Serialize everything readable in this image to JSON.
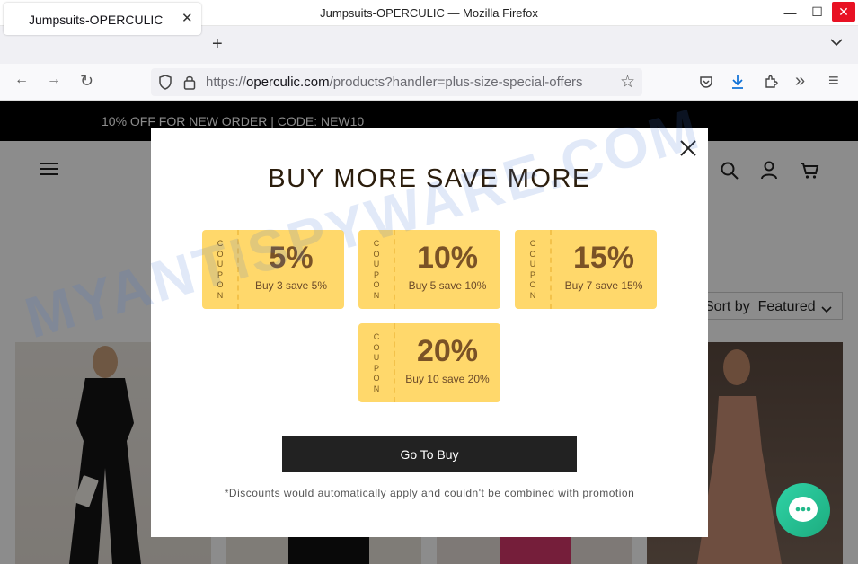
{
  "window": {
    "title": "Jumpsuits-OPERCULIC — Mozilla Firefox",
    "minimize": "—",
    "maximize": "☐",
    "close": "✕"
  },
  "tab": {
    "title": "Jumpsuits-OPERCULIC",
    "close": "✕",
    "new_tab": "+",
    "list_tabs": "⌄"
  },
  "nav": {
    "back": "←",
    "forward": "→",
    "reload": "↻",
    "url_scheme": "https://",
    "url_host": "operculic.com",
    "url_path": "/products?handler=plus-size-special-offers",
    "bookmark": "☆",
    "menu": "≡",
    "overflow": "»"
  },
  "page": {
    "promo": "10% OFF FOR NEW ORDER | CODE: NEW10",
    "sort_label": "Sort by",
    "sort_value": "Featured",
    "sort_chevron": "⌄"
  },
  "modal": {
    "close": "✕",
    "title": "BUY MORE SAVE MORE",
    "coupon_word": [
      "C",
      "O",
      "U",
      "P",
      "O",
      "N"
    ],
    "coupons": [
      {
        "percent": "5%",
        "desc": "Buy 3 save 5%"
      },
      {
        "percent": "10%",
        "desc": "Buy 5 save 10%"
      },
      {
        "percent": "15%",
        "desc": "Buy 7 save 15%"
      },
      {
        "percent": "20%",
        "desc": "Buy 10 save 20%"
      }
    ],
    "button": "Go To Buy",
    "disclaimer": "*Discounts would automatically apply and couldn't be combined with promotion"
  },
  "watermark": "MYANTISPYWARE.COM",
  "colors": {
    "coupon_bg": "#ffd86b",
    "coupon_text": "#7a5226",
    "button_bg": "#222222",
    "chat_bg": "#2fd3a6"
  }
}
